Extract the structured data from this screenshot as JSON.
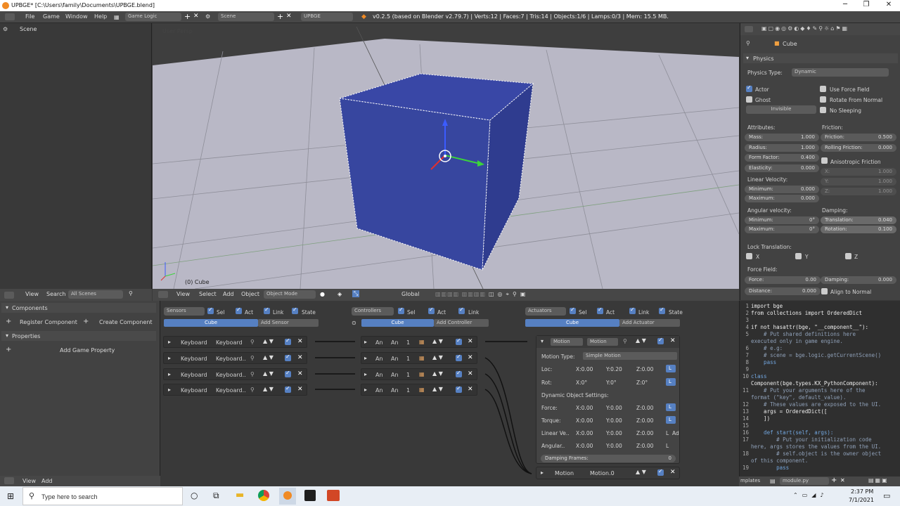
{
  "window": {
    "title": "UPBGE* [C:\\Users\\family\\Documents\\UPBGE.blend]",
    "minimize": "─",
    "maximize": "❐",
    "close": "✕"
  },
  "infobar": {
    "menus": [
      "File",
      "Game",
      "Window",
      "Help"
    ],
    "screen_layout": "Game Logic",
    "scene": "Scene",
    "engine": "UPBGE",
    "stats": "v0.2.5 (based on Blender v2.79.7) | Verts:12 | Faces:7 | Tris:14 | Objects:1/6 | Lamps:0/3 | Mem: 15.5 MB."
  },
  "outliner": {
    "item": "Scene"
  },
  "viewport": {
    "view_label": "User Persp",
    "object_label": "(0) Cube",
    "menus": [
      "View",
      "Select",
      "Add",
      "Object"
    ],
    "mode": "Object Mode",
    "orientation": "Global"
  },
  "outliner_header": {
    "view": "View",
    "search": "Search",
    "filter": "All Scenes"
  },
  "properties": {
    "object_name": "Cube",
    "section": "Physics",
    "physics_type_label": "Physics Type:",
    "physics_type": "Dynamic",
    "toggles_left": [
      {
        "label": "Actor",
        "checked": true
      },
      {
        "label": "Ghost",
        "checked": false
      },
      {
        "label": "Invisible",
        "checked": false
      }
    ],
    "toggles_right": [
      {
        "label": "Use Force Field",
        "checked": false
      },
      {
        "label": "Rotate From Normal",
        "checked": false
      },
      {
        "label": "No Sleeping",
        "checked": false
      }
    ],
    "attributes": "Attributes:",
    "mass": {
      "label": "Mass:",
      "value": "1.000"
    },
    "radius": {
      "label": "Radius:",
      "value": "1.000"
    },
    "form_factor": {
      "label": "Form Factor:",
      "value": "0.400"
    },
    "elasticity": {
      "label": "Elasticity:",
      "value": "0.000"
    },
    "friction_title": "Friction:",
    "friction": {
      "label": "Friction:",
      "value": "0.500"
    },
    "rolling_friction": {
      "label": "Rolling Friction:",
      "value": "0.000"
    },
    "anisotropic": "Anisotropic Friction",
    "aniso_x": {
      "label": "X:",
      "value": "1.000"
    },
    "aniso_y": {
      "label": "Y:",
      "value": "1.000"
    },
    "aniso_z": {
      "label": "Z:",
      "value": "1.000"
    },
    "linear_velocity": "Linear Velocity:",
    "lin_min": {
      "label": "Minimum:",
      "value": "0.000"
    },
    "lin_max": {
      "label": "Maximum:",
      "value": "0.000"
    },
    "angular_velocity": "Angular velocity:",
    "ang_min": {
      "label": "Minimum:",
      "value": "0°"
    },
    "ang_max": {
      "label": "Maximum:",
      "value": "0°"
    },
    "damping": "Damping:",
    "translation": {
      "label": "Translation:",
      "value": "0.040"
    },
    "rotation": {
      "label": "Rotation:",
      "value": "0.100"
    },
    "lock_translation": "Lock Translation:",
    "lock_x": "X",
    "lock_y": "Y",
    "lock_z": "Z",
    "force_field": "Force Field:",
    "force": {
      "label": "Force:",
      "value": "0.00"
    },
    "ff_damping": {
      "label": "Damping:",
      "value": "0.000"
    },
    "distance": {
      "label": "Distance:",
      "value": "0.000"
    },
    "align_normal": "Align to Normal"
  },
  "components": {
    "title": "Components",
    "register": "Register Component",
    "create": "Create Component",
    "properties_title": "Properties",
    "add_prop": "Add Game Property",
    "bottom_view": "View",
    "bottom_add": "Add"
  },
  "logic": {
    "sensors": "Sensors",
    "controllers": "Controllers",
    "actuators": "Actuators",
    "sel": "Sel",
    "act": "Act",
    "link": "Link",
    "state": "State",
    "obj": "Cube",
    "add_sensor": "Add Sensor",
    "add_controller": "Add Controller",
    "add_actuator": "Add Actuator",
    "sensor_rows": [
      {
        "type": "Keyboard",
        "name": "Keyboard"
      },
      {
        "type": "Keyboard",
        "name": "Keyboard.."
      },
      {
        "type": "Keyboard",
        "name": "Keyboard.."
      },
      {
        "type": "Keyboard",
        "name": "Keyboard.."
      }
    ],
    "controller_rows": [
      {
        "type": "An",
        "name": "An",
        "n": "1"
      },
      {
        "type": "An",
        "name": "An",
        "n": "1"
      },
      {
        "type": "An",
        "name": "An",
        "n": "1"
      },
      {
        "type": "An",
        "name": "An",
        "n": "1"
      }
    ],
    "motion": {
      "type": "Motion",
      "name": "Motion",
      "motion_type_label": "Motion Type:",
      "motion_type": "Simple Motion",
      "loc": {
        "label": "Loc:",
        "x": "X:0.00",
        "y": "Y:0.20",
        "z": "Z:0.00"
      },
      "rot": {
        "label": "Rot:",
        "x": "X:0°",
        "y": "Y:0°",
        "z": "Z:0°"
      },
      "dyn": "Dynamic Object Settings:",
      "force": {
        "label": "Force:",
        "x": "X:0.00",
        "y": "Y:0.00",
        "z": "Z:0.00"
      },
      "torque": {
        "label": "Torque:",
        "x": "X:0.00",
        "y": "Y:0.00",
        "z": "Z:0.00"
      },
      "linear": {
        "label": "Linear Ve..",
        "x": "X:0.00",
        "y": "Y:0.00",
        "z": "Z:0.00"
      },
      "angular": {
        "label": "Angular..",
        "x": "X:0.00",
        "y": "Y:0.00",
        "z": "Z:0.00"
      },
      "damping": {
        "label": "Damping Frames:",
        "value": "0"
      },
      "local": "L",
      "add": "Ad"
    },
    "motion2": {
      "type": "Motion",
      "name": "Motion.0"
    }
  },
  "code": {
    "file": "module.py",
    "templates": "mplates",
    "lines": [
      {
        "n": "1",
        "t": "import bge"
      },
      {
        "n": "2",
        "t": "from collections import OrderedDict"
      },
      {
        "n": "3",
        "t": ""
      },
      {
        "n": "4",
        "t": "if not hasattr(bge, \"__component__\"):"
      },
      {
        "n": "5",
        "t": "    # Put shared definitions here"
      },
      {
        "n": "",
        "t": "executed only in game engine."
      },
      {
        "n": "6",
        "t": "    # e.g:"
      },
      {
        "n": "7",
        "t": "    # scene = bge.logic.getCurrentScene()"
      },
      {
        "n": "8",
        "t": "    pass"
      },
      {
        "n": "9",
        "t": ""
      },
      {
        "n": "10",
        "t": "class"
      },
      {
        "n": "",
        "t": "Component(bge.types.KX_PythonComponent):"
      },
      {
        "n": "11",
        "t": "    # Put your arguments here of the"
      },
      {
        "n": "",
        "t": "format (\"key\", default_value)."
      },
      {
        "n": "12",
        "t": "    # These values are exposed to the UI."
      },
      {
        "n": "13",
        "t": "    args = OrderedDict(["
      },
      {
        "n": "14",
        "t": "    ])"
      },
      {
        "n": "15",
        "t": ""
      },
      {
        "n": "16",
        "t": "    def start(self, args):"
      },
      {
        "n": "17",
        "t": "        # Put your initialization code"
      },
      {
        "n": "",
        "t": "here, args stores the values from the UI."
      },
      {
        "n": "18",
        "t": "        # self.object is the owner object"
      },
      {
        "n": "",
        "t": "of this component."
      },
      {
        "n": "19",
        "t": "        pass"
      }
    ]
  },
  "taskbar": {
    "search": "Type here to search",
    "time": "2:37 PM",
    "date": "7/1/2021"
  }
}
